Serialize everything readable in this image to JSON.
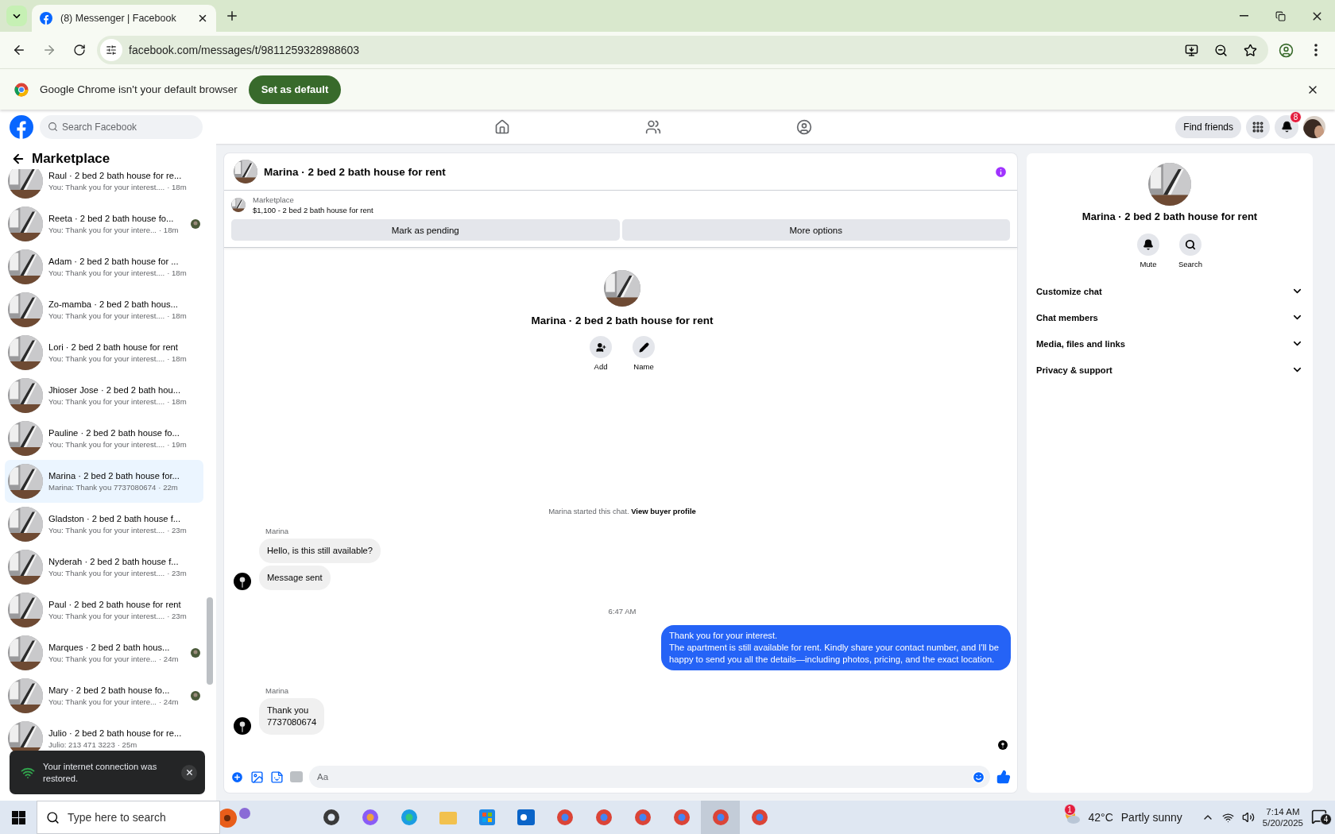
{
  "browser": {
    "tabs": [
      {
        "title": "(8) Messenger | Facebook",
        "selected": true
      }
    ],
    "url": "facebook.com/messages/t/9811259328988603",
    "infobar": {
      "message": "Google Chrome isn't your default browser",
      "button": "Set as default"
    }
  },
  "header": {
    "search_placeholder": "Search Facebook",
    "find_friends": "Find friends",
    "notification_count": "8"
  },
  "sidebar": {
    "title": "Marketplace",
    "conversations": [
      {
        "title": "Raul · 2 bed 2 bath house for re...",
        "preview": "You: Thank you for your interest....",
        "time": "· 18m",
        "selected": false,
        "read_receipt": false
      },
      {
        "title": "Reeta · 2 bed 2 bath house fo...",
        "preview": "You: Thank you for your intere...",
        "time": "· 18m",
        "selected": false,
        "read_receipt": true
      },
      {
        "title": "Adam · 2 bed 2 bath house for ...",
        "preview": "You: Thank you for your interest....",
        "time": "· 18m",
        "selected": false,
        "read_receipt": false
      },
      {
        "title": "Zo-mamba · 2 bed 2 bath hous...",
        "preview": "You: Thank you for your interest....",
        "time": "· 18m",
        "selected": false,
        "read_receipt": false
      },
      {
        "title": "Lori · 2 bed 2 bath house for rent",
        "preview": "You: Thank you for your interest....",
        "time": "· 18m",
        "selected": false,
        "read_receipt": false
      },
      {
        "title": "Jhioser Jose · 2 bed 2 bath hou...",
        "preview": "You: Thank you for your interest....",
        "time": "· 18m",
        "selected": false,
        "read_receipt": false
      },
      {
        "title": "Pauline · 2 bed 2 bath house fo...",
        "preview": "You: Thank you for your interest....",
        "time": "· 19m",
        "selected": false,
        "read_receipt": false
      },
      {
        "title": "Marina · 2 bed 2 bath house for...",
        "preview": "Marina: Thank you 7737080674",
        "time": "· 22m",
        "selected": true,
        "read_receipt": false
      },
      {
        "title": "Gladston · 2 bed 2 bath house f...",
        "preview": "You: Thank you for your interest....",
        "time": "· 23m",
        "selected": false,
        "read_receipt": false
      },
      {
        "title": "Nyderah · 2 bed 2 bath house f...",
        "preview": "You: Thank you for your interest....",
        "time": "· 23m",
        "selected": false,
        "read_receipt": false
      },
      {
        "title": "Paul · 2 bed 2 bath house for rent",
        "preview": "You: Thank you for your interest....",
        "time": "· 23m",
        "selected": false,
        "read_receipt": false
      },
      {
        "title": "Marques · 2 bed 2 bath hous...",
        "preview": "You: Thank you for your intere...",
        "time": "· 24m",
        "selected": false,
        "read_receipt": true
      },
      {
        "title": "Mary · 2 bed 2 bath house fo...",
        "preview": "You: Thank you for your intere...",
        "time": "· 24m",
        "selected": false,
        "read_receipt": true
      },
      {
        "title": "Julio · 2 bed 2 bath house for re...",
        "preview": "Julio: 213 471 3223",
        "time": "· 25m",
        "selected": false,
        "read_receipt": false
      }
    ]
  },
  "toast": {
    "message": "Your internet connection was restored."
  },
  "chat": {
    "title": "Marina · 2 bed 2 bath house for rent",
    "listing": {
      "source": "Marketplace",
      "title": "$1,100 - 2 bed 2 bath house for rent"
    },
    "buttons": [
      "Mark as pending",
      "More options"
    ],
    "intro": {
      "title": "Marina · 2 bed 2 bath house for rent",
      "actions": [
        {
          "kind": "add",
          "label": "Add"
        },
        {
          "kind": "name",
          "label": "Name"
        }
      ]
    },
    "notice": {
      "text": "Marina started this chat.",
      "link": "View buyer profile"
    },
    "messages": [
      {
        "kind": "sender",
        "text": "Marina"
      },
      {
        "kind": "incoming",
        "text": "Hello, is this still available?",
        "avatar": false
      },
      {
        "kind": "incoming",
        "text": "Message sent",
        "avatar": true
      },
      {
        "kind": "timestamp",
        "text": "6:47 AM"
      },
      {
        "kind": "outgoing",
        "text": "Thank you for your interest.\nThe apartment is still available for rent. Kindly share your contact number, and I'll be happy to send you all the details—including photos, pricing, and the exact location."
      },
      {
        "kind": "sender",
        "text": "Marina"
      },
      {
        "kind": "incoming",
        "text": "Thank you\n7737080674",
        "avatar": true
      }
    ],
    "composer_placeholder": "Aa"
  },
  "details": {
    "title": "Marina · 2 bed 2 bath house for rent",
    "actions": [
      {
        "kind": "mute",
        "label": "Mute"
      },
      {
        "kind": "search",
        "label": "Search"
      }
    ],
    "sections": [
      "Customize chat",
      "Chat members",
      "Media, files and links",
      "Privacy & support"
    ]
  },
  "taskbar": {
    "search_placeholder": "Type here to search",
    "weather_badge": "1",
    "temperature": "42°C",
    "condition": "Partly sunny",
    "time": "7:14 AM",
    "date": "5/20/2025",
    "notification_count": "4"
  }
}
